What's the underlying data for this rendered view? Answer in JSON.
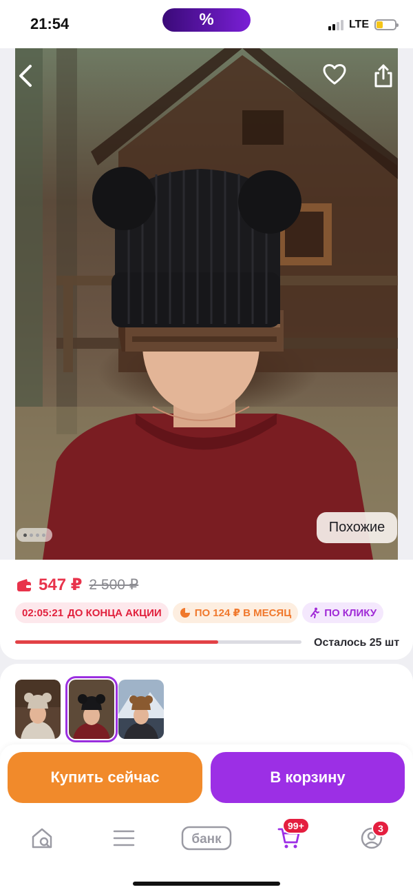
{
  "status_bar": {
    "time": "21:54",
    "promo_symbol": "%",
    "network": "LTE",
    "battery_level": 0.35
  },
  "hero": {
    "back_icon": "chevron-left-icon",
    "favorite_icon": "heart-outline-icon",
    "share_icon": "share-icon",
    "gallery_total": 4,
    "gallery_current": 1,
    "similar_label": "Похожие"
  },
  "price": {
    "current": "547 ₽",
    "old": "2 500 ₽",
    "wallet_icon": "wallet-icon",
    "accent_color": "#e8334b"
  },
  "chips": {
    "timer": "02:05:21",
    "timer_text": "ДО КОНЦА АКЦИИ",
    "installment": "ПО 124 ₽ В МЕСЯЦ",
    "one_click": "ПО КЛИКУ"
  },
  "stock": {
    "progress": 0.71,
    "label": "Осталось 25 шт"
  },
  "variants": {
    "count": 3,
    "selected_index": 1
  },
  "actions": {
    "buy_now": "Купить сейчас",
    "add_to_cart": "В корзину",
    "buy_color": "#f18a2b",
    "cart_color": "#9c2fe5"
  },
  "tabbar": {
    "items": [
      {
        "icon": "home-search-icon"
      },
      {
        "icon": "menu-icon"
      },
      {
        "icon": "bank-icon",
        "label": "банк"
      },
      {
        "icon": "cart-icon",
        "badge": "99+"
      },
      {
        "icon": "profile-icon",
        "badge": "3"
      }
    ]
  }
}
